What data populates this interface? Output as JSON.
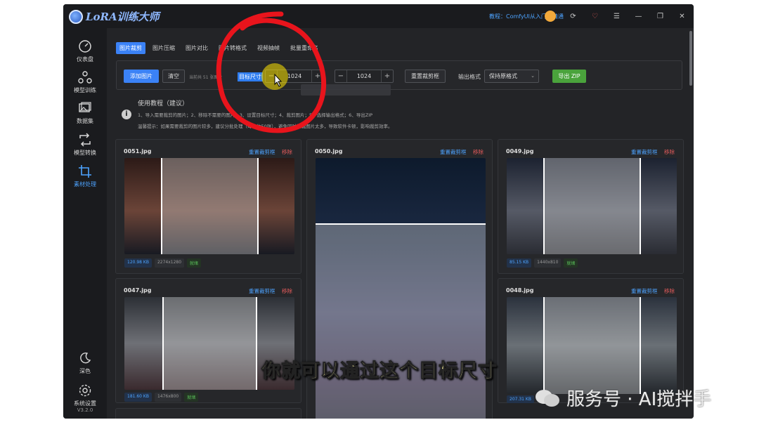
{
  "app": {
    "title": "LoRA训练大师",
    "tutorial_link": "教程：ComfyUI从入门到精通",
    "version": "V3.2.0"
  },
  "sidebar": {
    "items": [
      {
        "label": "仪表盘",
        "icon": "gauge-icon"
      },
      {
        "label": "模型训练",
        "icon": "network-icon"
      },
      {
        "label": "数据集",
        "icon": "images-icon"
      },
      {
        "label": "模型转换",
        "icon": "convert-icon"
      },
      {
        "label": "素材处理",
        "icon": "crop-icon",
        "active": true
      }
    ],
    "bottom": [
      {
        "label": "深色",
        "icon": "moon-icon"
      },
      {
        "label": "系统设置",
        "icon": "gear-icon"
      }
    ]
  },
  "tabs": [
    "图片裁剪",
    "图片压缩",
    "图片对比",
    "图片转格式",
    "视频抽帧",
    "批量重命名"
  ],
  "toolbar": {
    "add_images": "添加图片",
    "clear": "清空",
    "count_text": "当前共 51 张图片",
    "target_size_label": "目标尺寸",
    "width": "1024",
    "height": "1024",
    "reset_crop": "重置裁剪框",
    "output_format_label": "输出格式",
    "output_format_value": "保持原格式",
    "export_zip": "导出 ZIP",
    "minus": "−",
    "plus": "+"
  },
  "guide": {
    "title": "使用教程（建议）",
    "line1": "1、导入需要裁剪的图片；2、移除不需要的图片；3、设置目标尺寸；4、裁剪图片；5、选择输出格式；6、导出ZIP",
    "line2": "温馨提示：如果需要裁剪的图片较多，建议分批处理（每次约50张），避免同时加载图片太多，导致软件卡顿，影响裁剪效率。"
  },
  "cards": [
    {
      "name": "0051.jpg",
      "size": "120.98 KB",
      "dims": "2274x1280",
      "status": "就绪",
      "reset": "重置裁剪框",
      "remove": "移除",
      "colors": [
        "#2c1a17",
        "#6b4438",
        "#181a22"
      ],
      "crop": [
        0.22,
        0.79
      ]
    },
    {
      "name": "0050.jpg",
      "size": "",
      "dims": "",
      "status": "",
      "reset": "重置裁剪框",
      "remove": "移除",
      "colors": [
        "#0d1a2c",
        "#2a3a5a",
        "#0b1220"
      ],
      "crop": [
        0.25,
        0.72
      ]
    },
    {
      "name": "0049.jpg",
      "size": "85.15 KB",
      "dims": "1440x810",
      "status": "就绪",
      "reset": "重置裁剪框",
      "remove": "移除",
      "colors": [
        "#1c2230",
        "#565a66",
        "#2a2c33"
      ],
      "crop": [
        0.22,
        0.79
      ]
    },
    {
      "name": "0047.jpg",
      "size": "181.60 KB",
      "dims": "1476x800",
      "status": "就绪",
      "reset": "重置裁剪框",
      "remove": "移除",
      "colors": [
        "#2c3036",
        "#6e7076",
        "#3a2a2e"
      ],
      "crop": [
        0.23,
        0.78
      ]
    },
    {
      "name": "0048.jpg",
      "size": "207.31 KB",
      "dims": "",
      "status": "",
      "reset": "重置裁剪框",
      "remove": "移除",
      "colors": [
        "#2b323d",
        "#6a7076",
        "#22262b"
      ],
      "crop": [
        0.22,
        0.79
      ]
    }
  ],
  "subtitle": "你就可以通过这个目标尺寸",
  "watermark": "服务号 · AI搅拌手",
  "colors": {
    "accent": "#3b82f6",
    "annotation": "#e8141c",
    "green": "#4aa33c"
  }
}
